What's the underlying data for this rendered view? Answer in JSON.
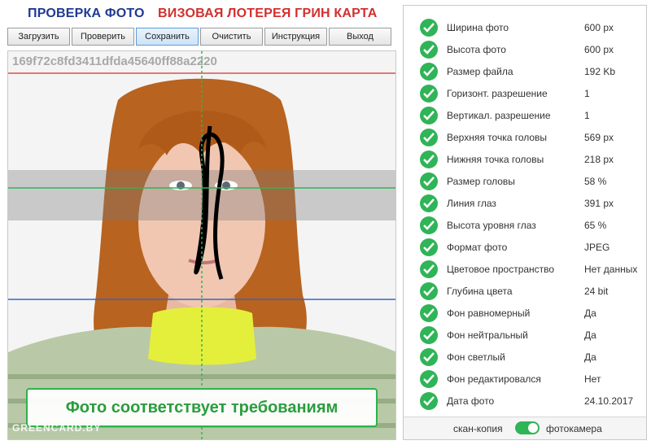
{
  "header": {
    "title_left": "ПРОВЕРКА ФОТО",
    "title_right": "ВИЗОВАЯ ЛОТЕРЕЯ ГРИН КАРТА"
  },
  "toolbar": {
    "buttons": [
      "Загрузить",
      "Проверить",
      "Сохранить",
      "Очистить",
      "Инструкция",
      "Выход"
    ],
    "active": "Сохранить"
  },
  "photo": {
    "hash": "169f72c8fd3411dfda45640ff88a2220",
    "verdict": "Фото соответствует требованиям",
    "watermark": "GREENCARD.BY"
  },
  "checks": [
    {
      "label": "Ширина фото",
      "value": "600 px",
      "status": "ok"
    },
    {
      "label": "Высота фото",
      "value": "600 px",
      "status": "ok"
    },
    {
      "label": "Размер файла",
      "value": "192 Kb",
      "status": "ok"
    },
    {
      "label": "Горизонт. разрешение",
      "value": "1",
      "status": "ok"
    },
    {
      "label": "Вертикал. разрешение",
      "value": "1",
      "status": "ok"
    },
    {
      "label": "Верхняя точка головы",
      "value": "569 px",
      "status": "ok"
    },
    {
      "label": "Нижняя точка головы",
      "value": "218 px",
      "status": "ok"
    },
    {
      "label": "Размер головы",
      "value": "58 %",
      "status": "ok"
    },
    {
      "label": "Линия глаз",
      "value": "391 px",
      "status": "ok"
    },
    {
      "label": "Высота уровня глаз",
      "value": "65 %",
      "status": "ok"
    },
    {
      "label": "Формат фото",
      "value": "JPEG",
      "status": "ok"
    },
    {
      "label": "Цветовое пространство",
      "value": "Нет данных",
      "status": "ok"
    },
    {
      "label": "Глубина цвета",
      "value": "24 bit",
      "status": "ok"
    },
    {
      "label": "Фон равномерный",
      "value": "Да",
      "status": "ok"
    },
    {
      "label": "Фон нейтральный",
      "value": "Да",
      "status": "ok"
    },
    {
      "label": "Фон светлый",
      "value": "Да",
      "status": "ok"
    },
    {
      "label": "Фон редактировался",
      "value": "Нет",
      "status": "ok"
    },
    {
      "label": "Дата фото",
      "value": "24.10.2017",
      "status": "ok"
    }
  ],
  "footer": {
    "scan_label": "скан-копия",
    "camera_label": "фотокамера",
    "toggle_on": true
  },
  "colors": {
    "title_blue": "#1f3a93",
    "title_red": "#d32f2f",
    "ok_green": "#2fb457"
  }
}
